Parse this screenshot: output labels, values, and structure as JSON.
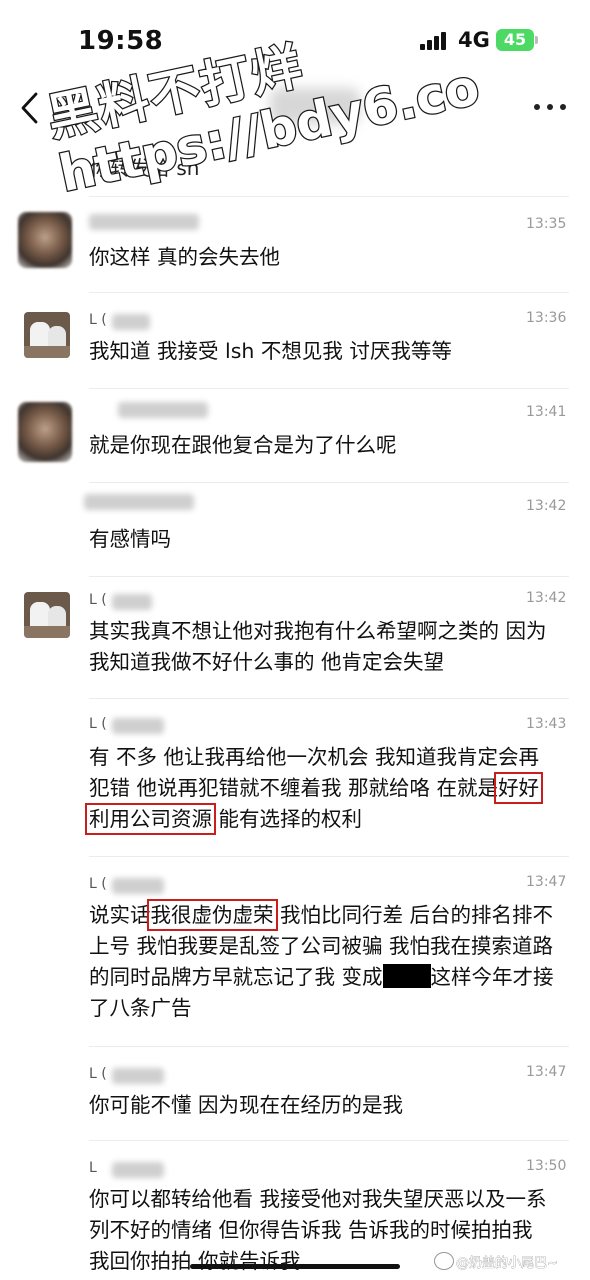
{
  "status": {
    "time": "19:58",
    "network": "4G",
    "battery": "45"
  },
  "watermark": {
    "line1": "黑料不打烊",
    "line2": "https://bdy6.co"
  },
  "top_partial_text": "你转发给 sh",
  "messages": [
    {
      "id": "m1",
      "name": "",
      "time": "13:35",
      "text": "你这样 真的会失去他",
      "avatar": "blurry"
    },
    {
      "id": "m2",
      "name": "L (",
      "time": "13:36",
      "text": "我知道 我接受 lsh 不想见我 讨厌我等等",
      "avatar": "cat"
    },
    {
      "id": "m3",
      "name": "",
      "time": "13:41",
      "text": "就是你现在跟他复合是为了什么呢",
      "avatar": "blurry"
    },
    {
      "id": "m4",
      "name": "",
      "time": "13:42",
      "text": "有感情吗",
      "avatar": "none"
    },
    {
      "id": "m5",
      "name": "L (",
      "time": "13:42",
      "text": "其实我真不想让他对我抱有什么希望啊之类的 因为我知道我做不好什么事的 他肯定会失望",
      "avatar": "cat"
    },
    {
      "id": "m6",
      "name": "L (",
      "time": "13:43",
      "text_a": "有 不多 他让我再给他一次机会 我知道我肯定会再犯错 他说再犯错就不缠着我 那就给咯 在就是",
      "highlight": "好好利用公司资源",
      "text_b": "能有选择的权利",
      "avatar": "none"
    },
    {
      "id": "m7",
      "name": "L (",
      "time": "13:47",
      "text_a": "说实话",
      "highlight": "我很虚伪虚荣",
      "text_b": "我怕比同行差 后台的排名排不上号 我怕我要是乱签了公司被骗 我怕我在摸索道路的同时品牌方早就忘记了我 变成",
      "text_c": "这样今年才接了八条广告",
      "avatar": "none"
    },
    {
      "id": "m8",
      "name": "L (",
      "time": "13:47",
      "text": "你可能不懂 因为现在在经历的是我",
      "avatar": "none"
    },
    {
      "id": "m9",
      "name": "L ",
      "time": "13:50",
      "text": "你可以都转给他看 我接受他对我失望厌恶以及一系列不好的情绪 但你得告诉我 告诉我的时候拍拍我 我回你拍拍 你就告诉我",
      "avatar": "none"
    }
  ],
  "footer": {
    "weibo_handle": "@奶盖的小尾巴~"
  }
}
